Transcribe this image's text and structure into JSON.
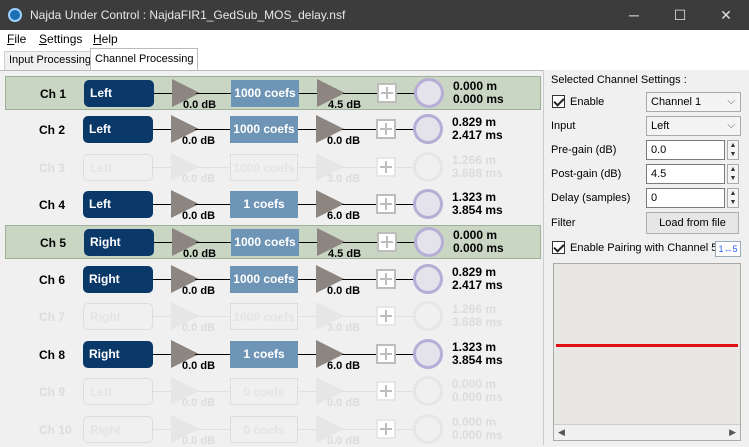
{
  "window": {
    "title": "Najda Under Control : NajdaFIR1_GedSub_MOS_delay.nsf",
    "minimize": "─",
    "maximize": "☐",
    "close": "✕"
  },
  "menu": [
    {
      "label_u": "F",
      "label_rest": "ile"
    },
    {
      "label_u": "S",
      "label_rest": "ettings"
    },
    {
      "label_u": "H",
      "label_rest": "elp"
    }
  ],
  "tabs": [
    "Input Processing",
    "Channel Processing"
  ],
  "channels": [
    {
      "name": "Ch 1",
      "source": "Left",
      "pre_gain": "0.0 dB",
      "coefs": "1000 coefs",
      "post_gain": "4.5 dB",
      "dist_m": "0.000 m",
      "dist_ms": "0.000 ms"
    },
    {
      "name": "Ch 2",
      "source": "Left",
      "pre_gain": "0.0 dB",
      "coefs": "1000 coefs",
      "post_gain": "0.0 dB",
      "dist_m": "0.829 m",
      "dist_ms": "2.417 ms"
    },
    {
      "name": "Ch 3",
      "source": "Left",
      "pre_gain": "0.0 dB",
      "coefs": "1000 coefs",
      "post_gain": "3.0 dB",
      "dist_m": "1.266 m",
      "dist_ms": "3.688 ms"
    },
    {
      "name": "Ch 4",
      "source": "Left",
      "pre_gain": "0.0 dB",
      "coefs": "1 coefs",
      "post_gain": "6.0 dB",
      "dist_m": "1.323 m",
      "dist_ms": "3.854 ms"
    },
    {
      "name": "Ch 5",
      "source": "Right",
      "pre_gain": "0.0 dB",
      "coefs": "1000 coefs",
      "post_gain": "4.5 dB",
      "dist_m": "0.000 m",
      "dist_ms": "0.000 ms"
    },
    {
      "name": "Ch 6",
      "source": "Right",
      "pre_gain": "0.0 dB",
      "coefs": "1000 coefs",
      "post_gain": "0.0 dB",
      "dist_m": "0.829 m",
      "dist_ms": "2.417 ms"
    },
    {
      "name": "Ch 7",
      "source": "Right",
      "pre_gain": "0.0 dB",
      "coefs": "1000 coefs",
      "post_gain": "3.0 dB",
      "dist_m": "1.266 m",
      "dist_ms": "3.688 ms"
    },
    {
      "name": "Ch 8",
      "source": "Right",
      "pre_gain": "0.0 dB",
      "coefs": "1 coefs",
      "post_gain": "6.0 dB",
      "dist_m": "1.323 m",
      "dist_ms": "3.854 ms"
    },
    {
      "name": "Ch 9",
      "source": "Left",
      "pre_gain": "0.0 dB",
      "coefs": "0 coefs",
      "post_gain": "0.0 dB",
      "dist_m": "0.000 m",
      "dist_ms": "0.000 ms"
    },
    {
      "name": "Ch 10",
      "source": "Right",
      "pre_gain": "0.0 dB",
      "coefs": "0 coefs",
      "post_gain": "0.0 dB",
      "dist_m": "0.000 m",
      "dist_ms": "0.000 ms"
    }
  ],
  "settings": {
    "heading": "Selected Channel Settings :",
    "enable_label": "Enable",
    "channel_value": "Channel 1",
    "input_label": "Input",
    "input_value": "Left",
    "pregain_label": "Pre-gain (dB)",
    "pregain_value": "0.0",
    "postgain_label": "Post-gain (dB)",
    "postgain_value": "4.5",
    "delay_label": "Delay (samples)",
    "delay_value": "0",
    "filter_label": "Filter",
    "load_button": "Load from file",
    "pairing_label": "Enable Pairing with Channel 5",
    "pair_badge": "1↔5"
  }
}
